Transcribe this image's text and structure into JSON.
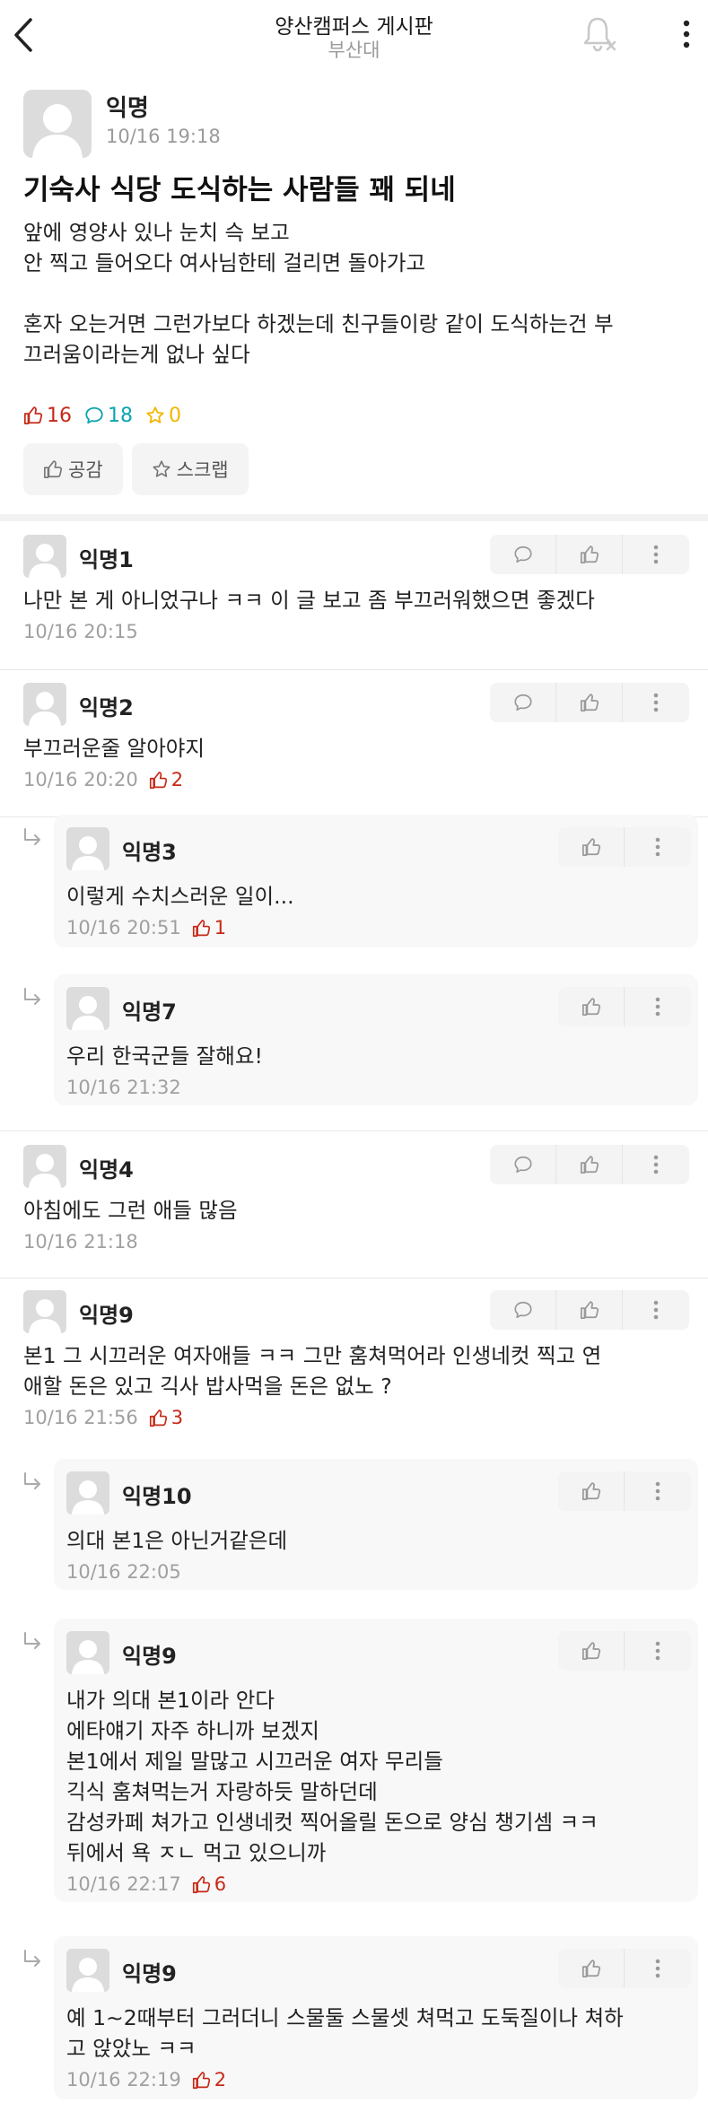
{
  "header": {
    "title": "양산캠퍼스 게시판",
    "subtitle": "부산대"
  },
  "post": {
    "author": "익명",
    "time": "10/16 19:18",
    "title": "기숙사 식당 도식하는 사람들 꽤 되네",
    "paragraph1": "앞에 영양사 있나 눈치 슥 보고\n안 찍고 들어오다 여사님한테 걸리면 돌아가고",
    "paragraph2": "혼자 오는거면 그런가보다 하겠는데 친구들이랑 같이 도식하는건 부\n끄러움이라는게 없나 싶다",
    "likes": "16",
    "comments": "18",
    "scraps": "0",
    "like_button": "공감",
    "scrap_button": "스크랩"
  },
  "comments": [
    {
      "author": "익명1",
      "text": "나만 본 게 아니었구나 ㅋㅋ 이 글 보고 좀 부끄러워했으면 좋겠다",
      "time": "10/16 20:15",
      "likes": ""
    },
    {
      "author": "익명2",
      "text": "부끄러운줄 알아야지",
      "time": "10/16 20:20",
      "likes": "2"
    },
    {
      "author": "익명3",
      "text": "이렇게 수치스러운 일이...",
      "time": "10/16 20:51",
      "likes": "1"
    },
    {
      "author": "익명7",
      "text": "우리 한국군들 잘해요!",
      "time": "10/16 21:32",
      "likes": ""
    },
    {
      "author": "익명4",
      "text": "아침에도 그런 애들 많음",
      "time": "10/16 21:18",
      "likes": ""
    },
    {
      "author": "익명9",
      "text": "본1 그 시끄러운 여자애들 ㅋㅋ 그만 훔쳐먹어라 인생네컷 찍고 연\n애할 돈은 있고 긱사 밥사먹을 돈은 없노 ?",
      "time": "10/16 21:56",
      "likes": "3"
    },
    {
      "author": "익명10",
      "text": "의대 본1은 아닌거같은데",
      "time": "10/16 22:05",
      "likes": ""
    },
    {
      "author": "익명9",
      "text": "내가 의대 본1이라 안다\n에타얘기 자주 하니까 보겠지\n본1에서 제일 말많고 시끄러운 여자 무리들\n긱식 훔쳐먹는거 자랑하듯 말하던데\n감성카페 쳐가고 인생네컷 찍어올릴 돈으로 양심 챙기셈 ㅋㅋ\n뒤에서 욕 ㅈㄴ 먹고 있으니까",
      "time": "10/16 22:17",
      "likes": "6"
    },
    {
      "author": "익명9",
      "text": "예 1~2때부터 그러더니 스물둘 스물셋 쳐먹고 도둑질이나 쳐하\n고 앉았노 ㅋㅋ",
      "time": "10/16 22:19",
      "likes": "2"
    }
  ],
  "colors": {
    "like": "#c62917",
    "comment": "#0ca5b0",
    "scrap": "#f2b600",
    "meta": "#a0a0a0"
  },
  "icons": {
    "back": "chevron-left-icon",
    "bell": "bell-off-icon",
    "more": "more-vertical-icon",
    "like": "thumbs-up-icon",
    "comment": "speech-bubble-icon",
    "scrap": "star-icon",
    "reply": "reply-arrow-icon"
  }
}
